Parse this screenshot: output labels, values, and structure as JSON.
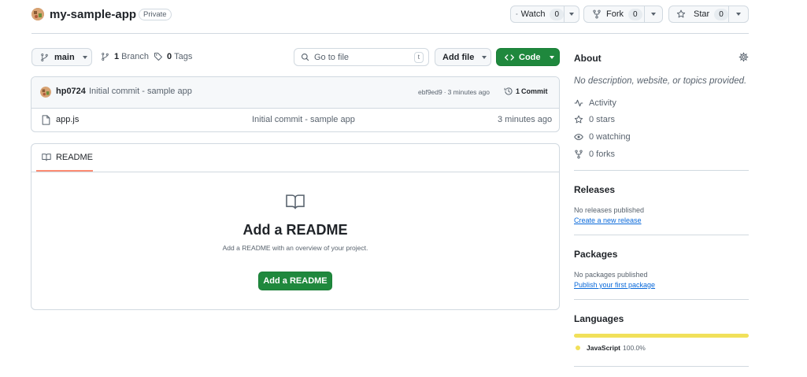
{
  "repo": {
    "name": "my-sample-app",
    "visibility": "Private",
    "avatar_icon": "owner-avatar-icon"
  },
  "header_actions": {
    "watch_label": "Watch",
    "watch_count": "0",
    "fork_label": "Fork",
    "fork_count": "0",
    "star_label": "Star",
    "star_count": "0"
  },
  "toolbar": {
    "branch": "main",
    "branches_count": "1",
    "branches_label": "Branch",
    "tags_count": "0",
    "tags_label": "Tags",
    "search_placeholder": "Go to file",
    "search_shortcut": "t",
    "add_file_label": "Add file",
    "code_label": "Code"
  },
  "commit": {
    "author": "hp0724",
    "message": "Initial commit - sample app",
    "sha": "ebf9ed9",
    "separator": "·",
    "time": "3 minutes ago",
    "commit_count": "1",
    "commit_label": "Commit"
  },
  "files": [
    {
      "name": "app.js",
      "message": "Initial commit - sample app",
      "time": "3 minutes ago",
      "icon": "file-icon"
    }
  ],
  "readme": {
    "tab_label": "README",
    "title": "Add a README",
    "description": "Add a README with an overview of your project.",
    "button_label": "Add a README"
  },
  "about": {
    "title": "About",
    "description": "No description, website, or topics provided.",
    "activity": "Activity",
    "stars": "0 stars",
    "watching": "0 watching",
    "forks": "0 forks"
  },
  "releases": {
    "title": "Releases",
    "empty": "No releases published",
    "link": "Create a new release"
  },
  "packages": {
    "title": "Packages",
    "empty": "No packages published",
    "link": "Publish your first package"
  },
  "languages": {
    "title": "Languages",
    "items": [
      {
        "name": "JavaScript",
        "percent": "100.0%",
        "fraction": 1.0,
        "color": "#f1e05a"
      }
    ]
  },
  "colors": {
    "primary_green": "#1f883d",
    "link_blue": "#0969da",
    "readme_tab_underline": "#fd8c73",
    "javascript": "#f1e05a"
  }
}
